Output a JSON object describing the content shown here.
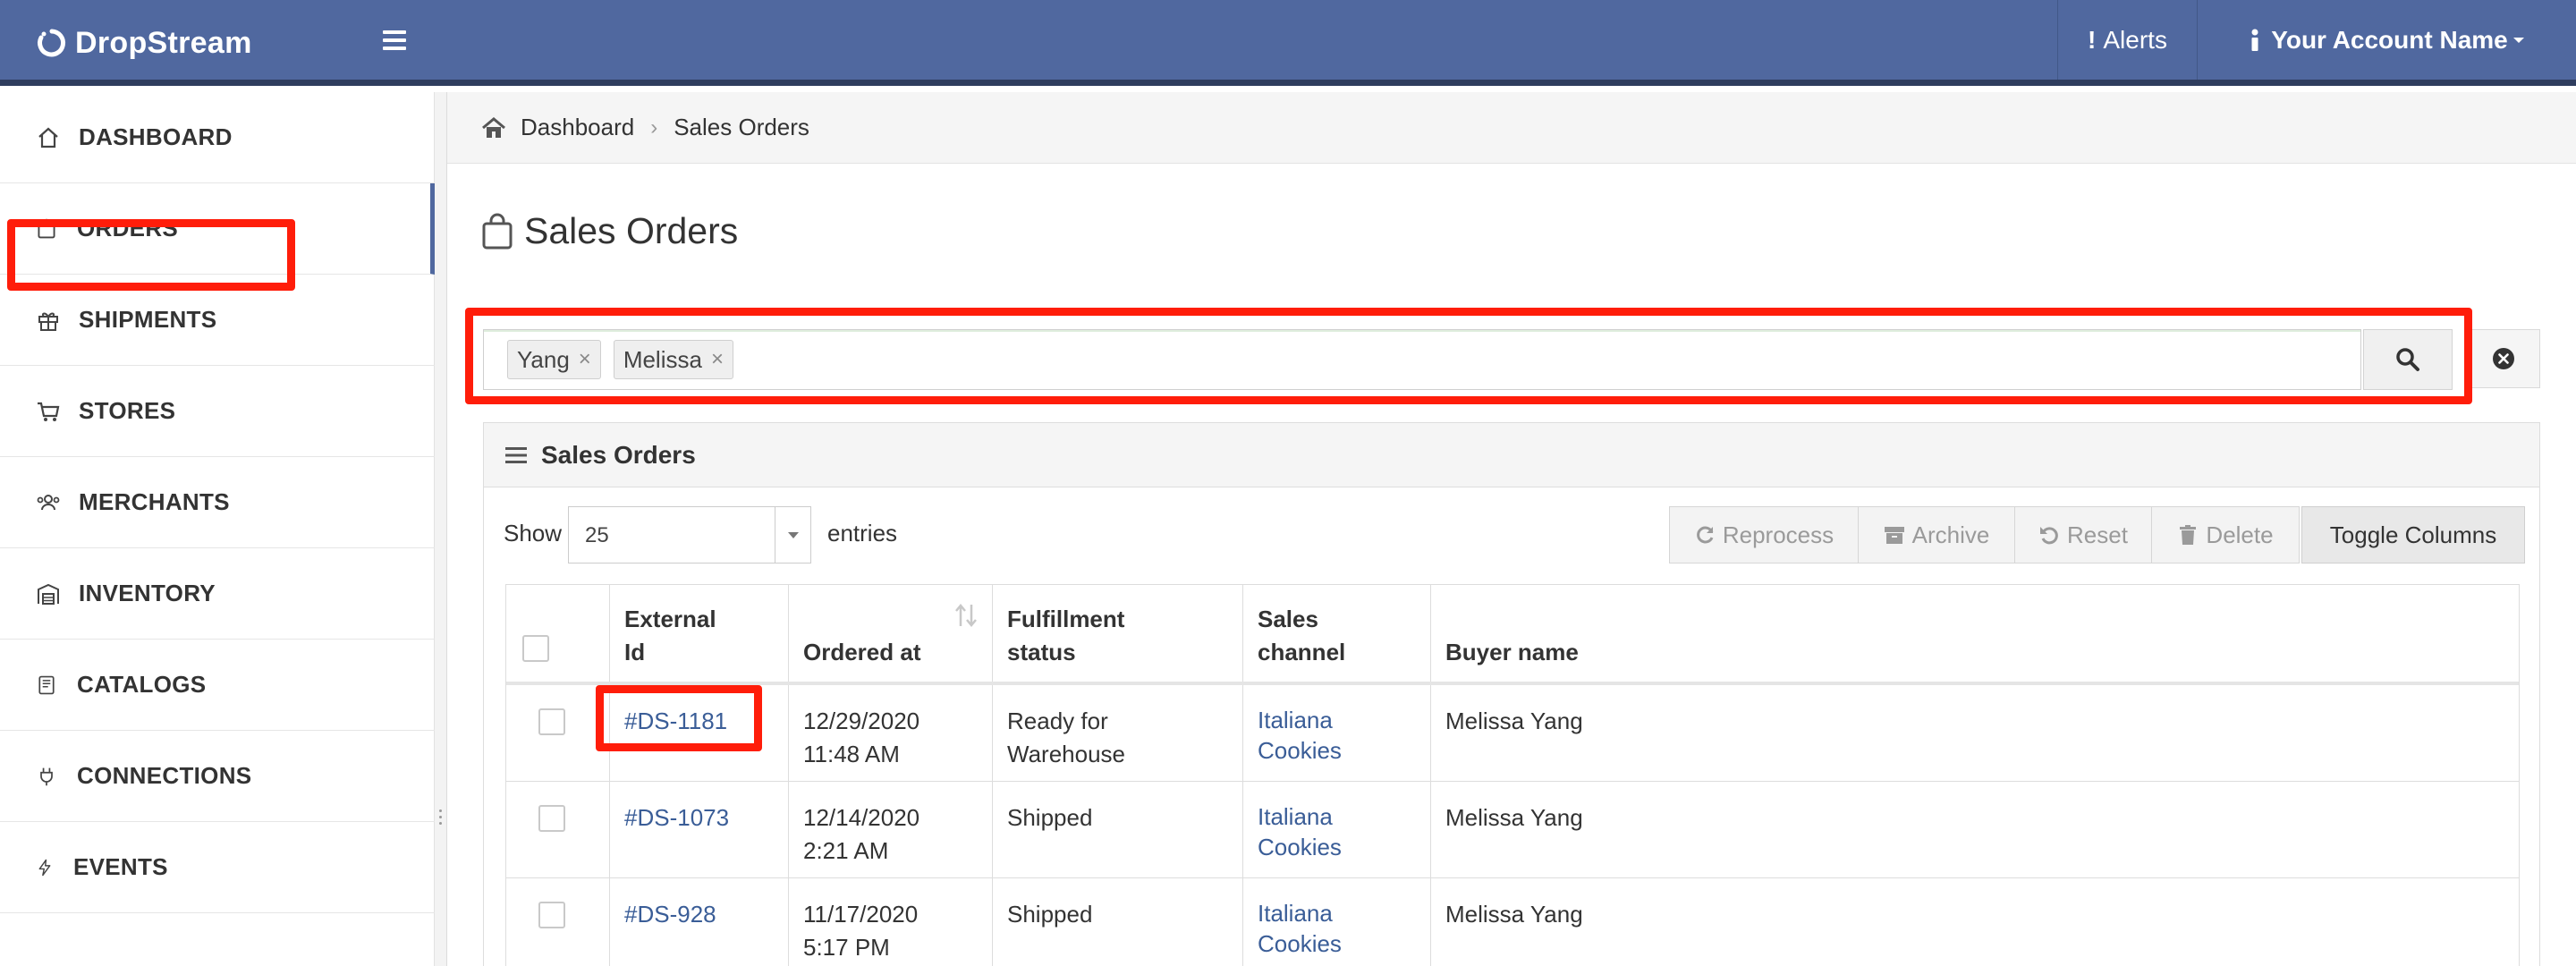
{
  "app": {
    "name": "DropStream"
  },
  "topbar": {
    "alerts_label": "Alerts",
    "account_label": "Your Account Name"
  },
  "sidebar": {
    "items": [
      {
        "label": "DASHBOARD",
        "icon": "home-icon"
      },
      {
        "label": "ORDERS",
        "icon": "shopping-bag-icon",
        "active": true
      },
      {
        "label": "SHIPMENTS",
        "icon": "gift-box-icon"
      },
      {
        "label": "STORES",
        "icon": "cart-icon"
      },
      {
        "label": "MERCHANTS",
        "icon": "users-icon"
      },
      {
        "label": "INVENTORY",
        "icon": "warehouse-icon"
      },
      {
        "label": "CATALOGS",
        "icon": "book-icon"
      },
      {
        "label": "CONNECTIONS",
        "icon": "plug-icon"
      },
      {
        "label": "EVENTS",
        "icon": "bolt-icon"
      }
    ]
  },
  "breadcrumb": {
    "items": [
      "Dashboard",
      "Sales Orders"
    ]
  },
  "page": {
    "title": "Sales Orders"
  },
  "search": {
    "tags": [
      "Yang",
      "Melissa"
    ]
  },
  "panel": {
    "title": "Sales Orders",
    "show_label": "Show",
    "entries_value": "25",
    "entries_label": "entries",
    "actions": {
      "reprocess": "Reprocess",
      "archive": "Archive",
      "reset": "Reset",
      "delete": "Delete",
      "toggle_columns": "Toggle Columns"
    }
  },
  "table": {
    "columns": [
      {
        "line1": "External",
        "line2": "Id"
      },
      {
        "line1": "",
        "line2": "Ordered at"
      },
      {
        "line1": "Fulfillment",
        "line2": "status"
      },
      {
        "line1": "Sales",
        "line2": "channel"
      },
      {
        "line1": "",
        "line2": "Buyer name"
      }
    ],
    "rows": [
      {
        "external_id": "#DS-1181",
        "date": "12/29/2020",
        "time": "11:48 AM",
        "status_line1": "Ready for",
        "status_line2": "Warehouse",
        "channel_line1": "Italiana",
        "channel_line2": "Cookies",
        "buyer": "Melissa Yang"
      },
      {
        "external_id": "#DS-1073",
        "date": "12/14/2020",
        "time": "2:21 AM",
        "status_line1": "Shipped",
        "status_line2": "",
        "channel_line1": "Italiana",
        "channel_line2": "Cookies",
        "buyer": "Melissa Yang"
      },
      {
        "external_id": "#DS-928",
        "date": "11/17/2020",
        "time": "5:17 PM",
        "status_line1": "Shipped",
        "status_line2": "",
        "channel_line1": "Italiana",
        "channel_line2": "Cookies",
        "buyer": "Melissa Yang"
      }
    ]
  },
  "colors": {
    "topbar": "#50689f",
    "link": "#3a5d97",
    "highlight": "#ff1d0a"
  }
}
